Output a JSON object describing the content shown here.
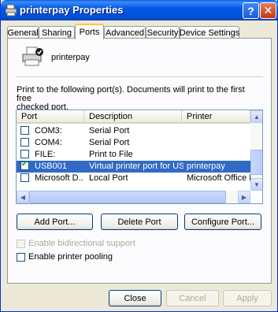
{
  "window": {
    "title": "printerpay Properties"
  },
  "tabs": [
    "General",
    "Sharing",
    "Ports",
    "Advanced",
    "Security",
    "Device Settings"
  ],
  "active_tab": "Ports",
  "printer": {
    "name": "printerpay"
  },
  "description": [
    "Print to the following port(s). Documents will print to the first free",
    "checked port."
  ],
  "ports": {
    "columns": [
      "Port",
      "Description",
      "Printer"
    ],
    "rows": [
      {
        "checked": false,
        "port": "COM3:",
        "description": "Serial Port",
        "printer": ""
      },
      {
        "checked": false,
        "port": "COM4:",
        "description": "Serial Port",
        "printer": ""
      },
      {
        "checked": false,
        "port": "FILE:",
        "description": "Print to File",
        "printer": ""
      },
      {
        "checked": true,
        "port": "USB001",
        "description": "Virtual printer port for USB",
        "printer": "printerpay",
        "selected": true
      },
      {
        "checked": false,
        "port": "Microsoft D...",
        "description": "Local Port",
        "printer": "Microsoft Office Do"
      }
    ]
  },
  "buttons": {
    "add_port": "Add Port...",
    "delete_port": "Delete Port",
    "configure_port": "Configure Port...",
    "close": "Close",
    "cancel": "Cancel",
    "apply": "Apply"
  },
  "options": {
    "bidirectional": {
      "label": "Enable bidirectional support",
      "checked": false,
      "enabled": false
    },
    "pooling": {
      "label": "Enable printer pooling",
      "checked": false,
      "enabled": true
    }
  }
}
